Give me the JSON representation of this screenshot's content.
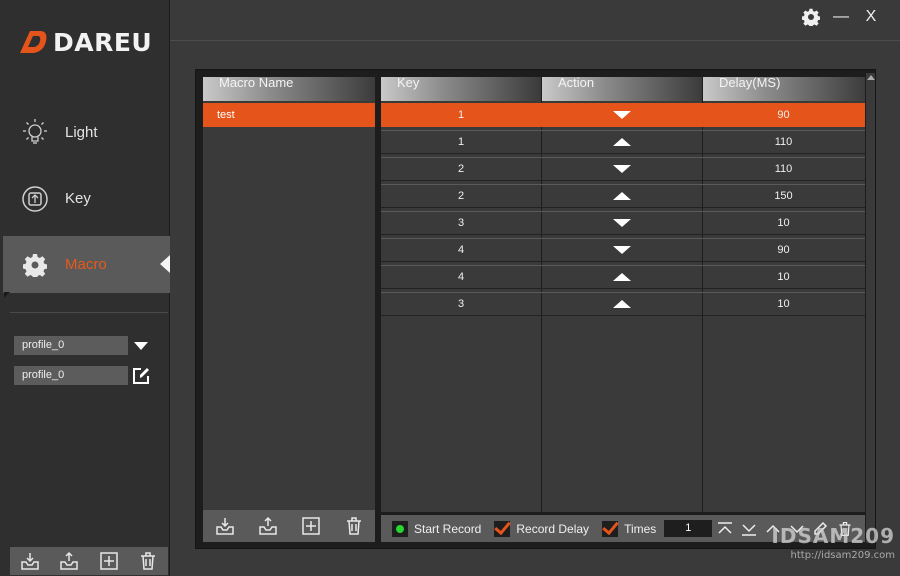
{
  "brand": {
    "logo_text": "DAREU",
    "accent_color": "#e5541a"
  },
  "window_controls": [
    {
      "name": "settings",
      "icon": "gear-icon"
    },
    {
      "name": "minimize",
      "label": "—"
    },
    {
      "name": "close",
      "label": "X"
    }
  ],
  "sidebar": {
    "nav": [
      {
        "id": "light",
        "label": "Light",
        "icon": "bulb-icon"
      },
      {
        "id": "key",
        "label": "Key",
        "icon": "keyboard-key-icon"
      },
      {
        "id": "macro",
        "label": "Macro",
        "icon": "gear-icon",
        "active": true
      }
    ],
    "profile_select": {
      "value": "profile_0"
    },
    "profile_name": {
      "value": "profile_0"
    },
    "toolbar": [
      "import-icon",
      "export-icon",
      "add-icon",
      "delete-icon"
    ]
  },
  "macro_list": {
    "header": "Macro Name",
    "items": [
      {
        "name": "test",
        "selected": true
      }
    ],
    "toolbar": [
      "import-icon",
      "export-icon",
      "add-icon",
      "delete-icon"
    ]
  },
  "events": {
    "headers": {
      "key": "Key",
      "action": "Action",
      "delay": "Delay(MS)"
    },
    "rows": [
      {
        "key": "1",
        "action": "down",
        "delay": "90",
        "selected": true
      },
      {
        "key": "1",
        "action": "up",
        "delay": "110"
      },
      {
        "key": "2",
        "action": "down",
        "delay": "110"
      },
      {
        "key": "2",
        "action": "up",
        "delay": "150"
      },
      {
        "key": "3",
        "action": "down",
        "delay": "10"
      },
      {
        "key": "4",
        "action": "down",
        "delay": "90"
      },
      {
        "key": "4",
        "action": "up",
        "delay": "10"
      },
      {
        "key": "3",
        "action": "up",
        "delay": "10"
      }
    ]
  },
  "record_bar": {
    "start_record_label": "Start Record",
    "record_delay_label": "Record Delay",
    "record_delay_checked": true,
    "times_label": "Times",
    "times_checked": true,
    "times_value": "1"
  },
  "watermark": {
    "main": "IDSAM209",
    "sub": "http://idsam209.com"
  }
}
